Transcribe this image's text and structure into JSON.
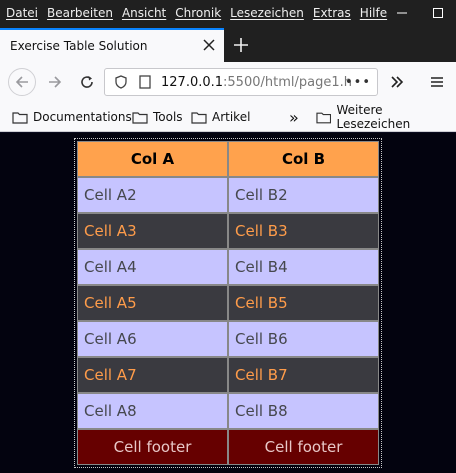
{
  "menubar": {
    "items": [
      "Datei",
      "Bearbeiten",
      "Ansicht",
      "Chronik",
      "Lesezeichen",
      "Extras",
      "Hilfe"
    ]
  },
  "tab": {
    "title": "Exercise Table Solution"
  },
  "urlbar": {
    "host": "127.0.0.1",
    "rest": ":5500/html/page1.h",
    "more": "•••"
  },
  "bookmarks": {
    "items": [
      "Documentations",
      "Tools",
      "Artikel"
    ],
    "overflow": "»",
    "other": "Weitere Lesezeichen"
  },
  "table": {
    "headers": [
      "Col A",
      "Col B"
    ],
    "rows": [
      [
        "Cell A2",
        "Cell B2"
      ],
      [
        "Cell A3",
        "Cell B3"
      ],
      [
        "Cell A4",
        "Cell B4"
      ],
      [
        "Cell A5",
        "Cell B5"
      ],
      [
        "Cell A6",
        "Cell B6"
      ],
      [
        "Cell A7",
        "Cell B7"
      ],
      [
        "Cell A8",
        "Cell B8"
      ]
    ],
    "footer": [
      "Cell footer",
      "Cell footer"
    ]
  },
  "colors": {
    "header_bg": "#ffa24d",
    "light_row_bg": "#c6c4ff",
    "dark_row_bg": "#3a3a40",
    "dark_row_text": "#ff9c4a",
    "footer_bg": "#660000",
    "page_bg": "#03030f"
  }
}
